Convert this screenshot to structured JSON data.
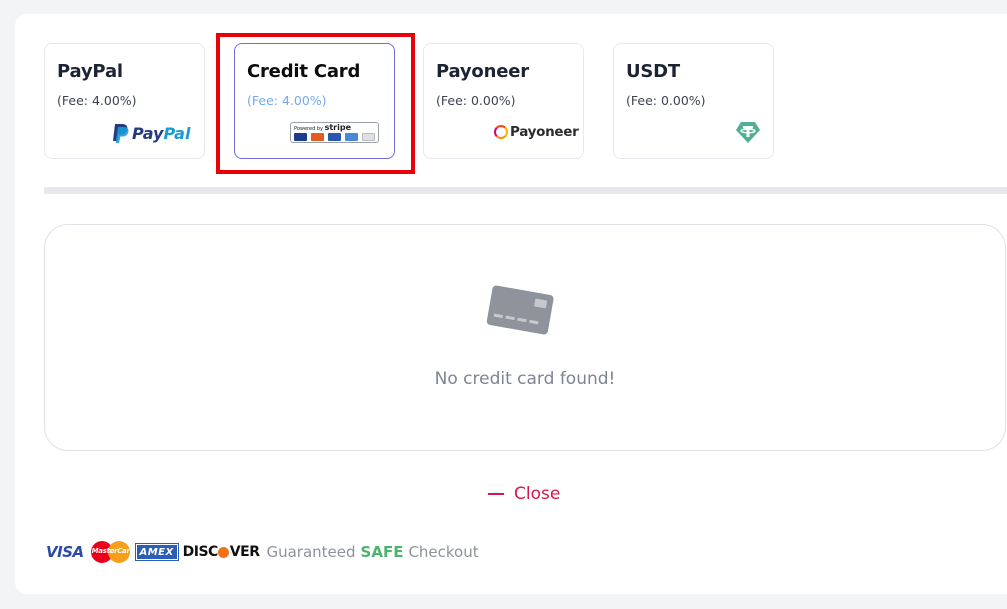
{
  "payment_methods": [
    {
      "name": "PayPal",
      "fee": "(Fee: 4.00%)",
      "logo": "paypal-logo",
      "selected": false
    },
    {
      "name": "Credit Card",
      "fee": "(Fee: 4.00%)",
      "logo": "stripe-card-logos",
      "selected": true
    },
    {
      "name": "Payoneer",
      "fee": "(Fee: 0.00%)",
      "logo": "payoneer-logo",
      "selected": false
    },
    {
      "name": "USDT",
      "fee": "(Fee: 0.00%)",
      "logo": "tether-logo",
      "selected": false
    }
  ],
  "logos": {
    "paypal_text_pay": "Pay",
    "paypal_text_pal": "Pal",
    "stripe_powered": "Powered by",
    "stripe_name": "stripe",
    "payoneer_text": "Payoneer"
  },
  "empty_state": {
    "icon": "credit-card-icon",
    "message": "No credit card found!"
  },
  "close_label": "Close",
  "footer": {
    "brands": [
      "VISA",
      "MasterCard",
      "AMEX",
      "DISCOVER"
    ],
    "text_before": "Guaranteed",
    "text_safe": "SAFE",
    "text_after": "Checkout"
  },
  "colors": {
    "selected_border": "#6f6fd6",
    "highlight": "#e8000b",
    "close": "#d6184a",
    "safe": "#4bb36d"
  }
}
